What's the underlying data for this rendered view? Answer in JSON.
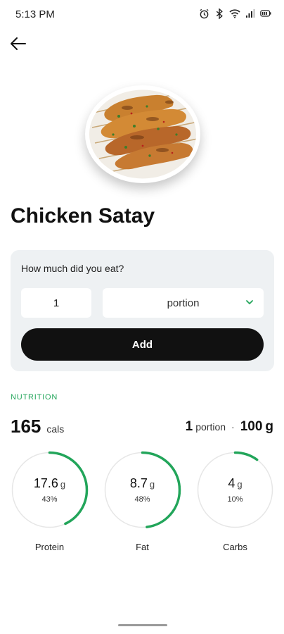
{
  "status_bar": {
    "time": "5:13 PM",
    "icons": [
      "alarm-icon",
      "bluetooth-icon",
      "wifi-icon",
      "signal-icon",
      "battery-icon"
    ]
  },
  "header": {
    "back_icon": "arrow-left-icon"
  },
  "food": {
    "name": "Chicken Satay"
  },
  "portion_form": {
    "question": "How much did you eat?",
    "quantity_value": "1",
    "unit_selected": "portion",
    "add_label": "Add"
  },
  "nutrition": {
    "section_label": "NUTRITION",
    "calories": "165",
    "calories_unit": "cals",
    "portion_qty": "1",
    "portion_unit": "portion",
    "separator": "·",
    "weight": "100",
    "weight_unit": "g",
    "macros": [
      {
        "name": "Protein",
        "value": "17.6",
        "unit": "g",
        "percent_label": "43%",
        "percent": 43
      },
      {
        "name": "Fat",
        "value": "8.7",
        "unit": "g",
        "percent_label": "48%",
        "percent": 48
      },
      {
        "name": "Carbs",
        "value": "4",
        "unit": "g",
        "percent_label": "10%",
        "percent": 10
      }
    ]
  },
  "colors": {
    "accent_green": "#22a55a",
    "ring_track": "#e6e6e6",
    "button_dark": "#111111",
    "card_bg": "#eef1f3"
  }
}
